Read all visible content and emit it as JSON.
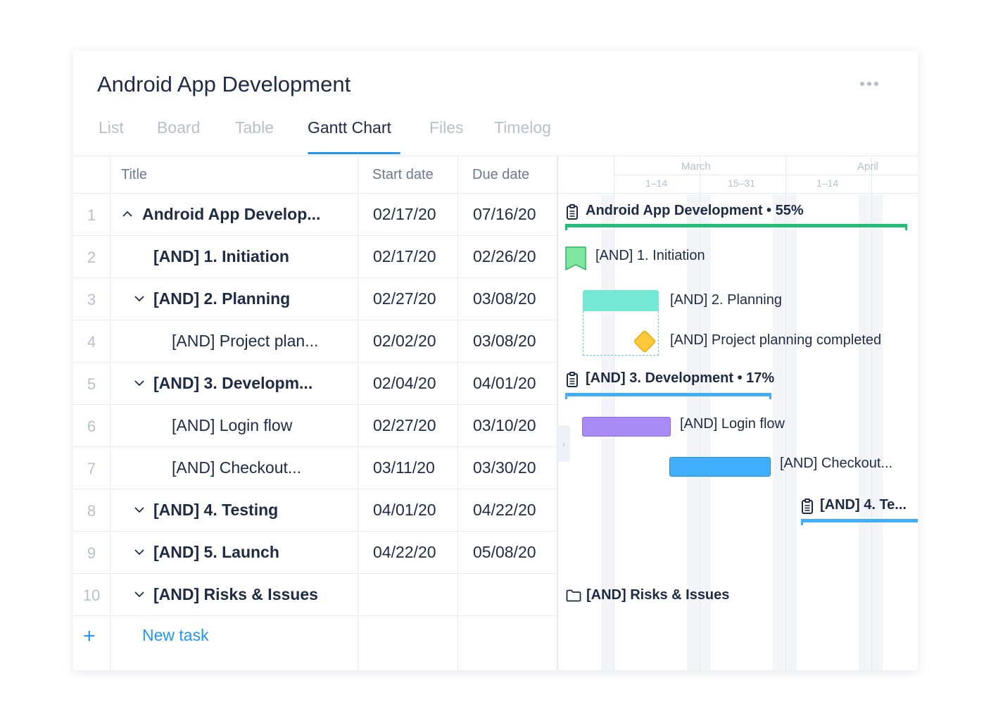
{
  "page": {
    "title": "Android App Development"
  },
  "tabs": [
    {
      "label": "List"
    },
    {
      "label": "Board"
    },
    {
      "label": "Table"
    },
    {
      "label": "Gantt Chart",
      "active": true
    },
    {
      "label": "Files"
    },
    {
      "label": "Timelog"
    }
  ],
  "columns": {
    "title": "Title",
    "start": "Start date",
    "due": "Due date"
  },
  "rows": [
    {
      "num": "1",
      "title": "Android App Develop...",
      "start": "02/17/20",
      "due": "07/16/20",
      "bold": true,
      "caret": "up"
    },
    {
      "num": "2",
      "title": "[AND] 1. Initiation",
      "start": "02/17/20",
      "due": "02/26/20",
      "bold": true
    },
    {
      "num": "3",
      "title": "[AND] 2. Planning",
      "start": "02/27/20",
      "due": "03/08/20",
      "bold": true,
      "caret": "down"
    },
    {
      "num": "4",
      "title": "[AND] Project plan...",
      "start": "02/02/20",
      "due": "03/08/20",
      "bold": false
    },
    {
      "num": "5",
      "title": "[AND] 3. Developm...",
      "start": "02/04/20",
      "due": "04/01/20",
      "bold": true,
      "caret": "down"
    },
    {
      "num": "6",
      "title": "[AND] Login flow",
      "start": "02/27/20",
      "due": "03/10/20",
      "bold": false
    },
    {
      "num": "7",
      "title": "[AND] Checkout...",
      "start": "03/11/20",
      "due": "03/30/20",
      "bold": false
    },
    {
      "num": "8",
      "title": "[AND] 4. Testing",
      "start": "04/01/20",
      "due": "04/22/20",
      "bold": true,
      "caret": "down"
    },
    {
      "num": "9",
      "title": "[AND] 5. Launch",
      "start": "04/22/20",
      "due": "05/08/20",
      "bold": true,
      "caret": "down"
    },
    {
      "num": "10",
      "title": "[AND] Risks & Issues",
      "start": "",
      "due": "",
      "bold": true,
      "caret": "down"
    }
  ],
  "new_task": {
    "label": "New task"
  },
  "timeline": {
    "months": [
      "March",
      "April"
    ],
    "periods": [
      "1–14",
      "15–31",
      "1–14"
    ]
  },
  "gantt": {
    "project": {
      "label": "Android App Development • 55%",
      "color": "#1fbf75",
      "progress": 0.55
    },
    "initiation": {
      "label": "[AND] 1. Initiation",
      "color": "#7ee6a0"
    },
    "planning": {
      "label": "[AND] 2. Planning",
      "color": "#74e8d4"
    },
    "planning_done": {
      "label": "[AND] Project planning completed",
      "color": "#ffc93c"
    },
    "development": {
      "label": "[AND] 3. Development • 17%",
      "color": "#41aefc",
      "progress": 0.17
    },
    "login": {
      "label": "[AND] Login flow",
      "color": "#a98bf5"
    },
    "checkout": {
      "label": "[AND] Checkout...",
      "color": "#41aefc"
    },
    "testing": {
      "label": "[AND] 4. Te...",
      "color": "#41aefc"
    },
    "risks": {
      "label": "[AND] Risks & Issues"
    }
  }
}
